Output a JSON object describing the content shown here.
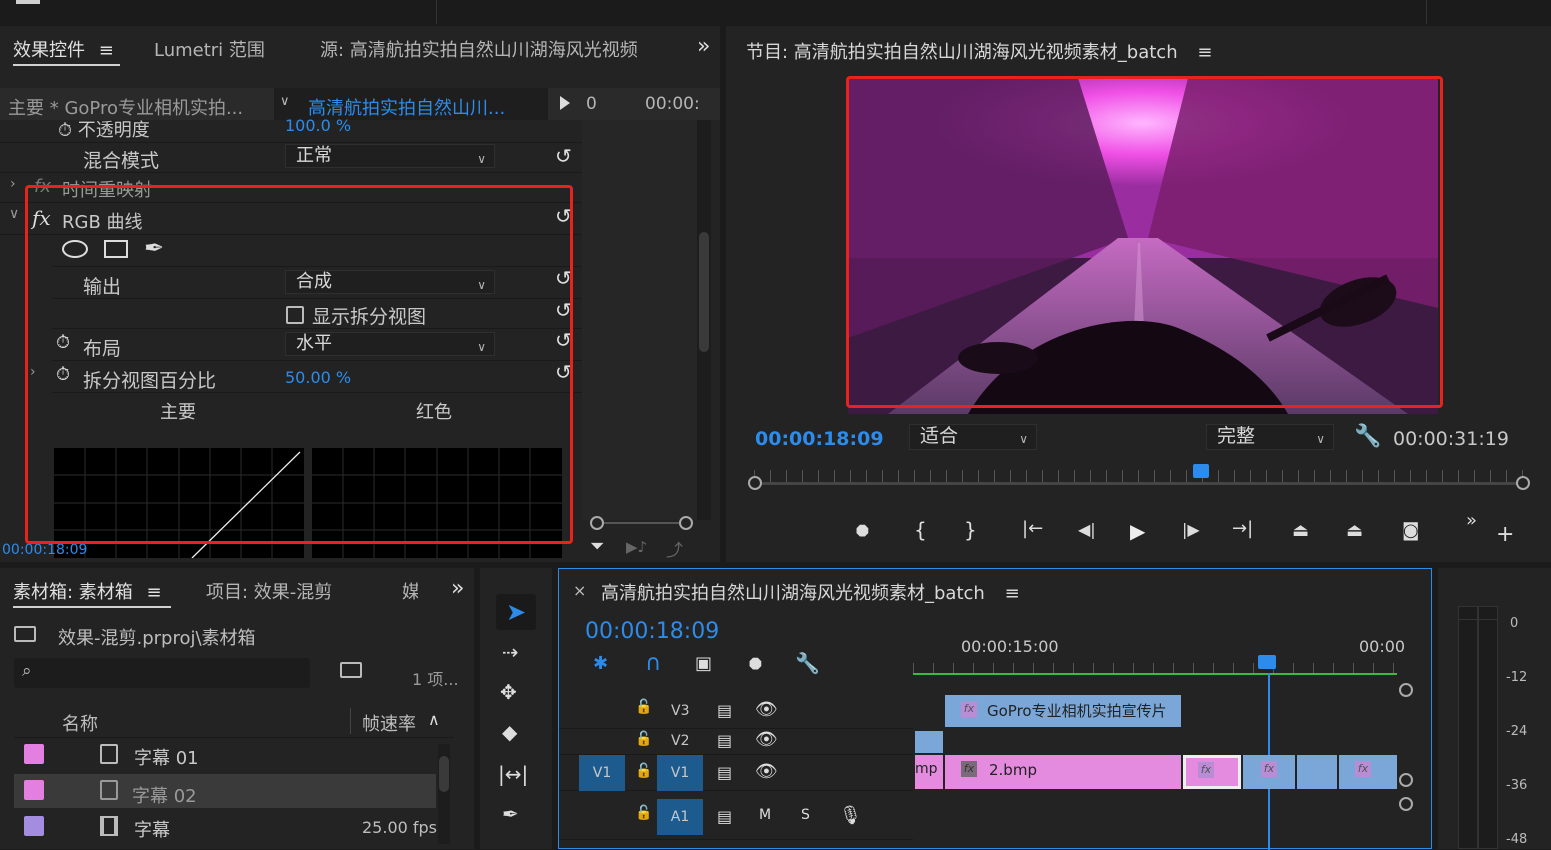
{
  "effect_controls": {
    "tabs": [
      "效果控件",
      "Lumetri 范围",
      "源: 高清航拍实拍自然山川湖海风光视频"
    ],
    "overflow": "»",
    "master_clip": "主要 * GoPro专业相机实拍...",
    "sequence_clip": "高清航拍实拍自然山川...",
    "ruler_times": [
      "0",
      "00:00:"
    ],
    "rows": {
      "opacity_label": "不透明度",
      "opacity_value": "100.0",
      "opacity_unit": "%",
      "blend_label": "混合模式",
      "blend_value": "正常",
      "timeremap_label": "时间重映射",
      "rgb_label": "RGB 曲线",
      "output_label": "输出",
      "output_value": "合成",
      "split_label": "显示拆分视图",
      "layout_label": "布局",
      "layout_value": "水平",
      "split_pct_label": "拆分视图百分比",
      "split_pct_value": "50.00",
      "split_pct_unit": "%",
      "curve_main": "主要",
      "curve_red": "红色"
    },
    "timecode": "00:00:18:09"
  },
  "program_monitor": {
    "title": "节目: 高清航拍实拍自然山川湖海风光视频素材_batch",
    "current_time": "00:00:18:09",
    "fit": "适合",
    "quality": "完整",
    "duration": "00:00:31:19",
    "playhead_fraction": 0.58
  },
  "bin_panel": {
    "tabs": [
      "素材箱: 素材箱",
      "项目: 效果-混剪",
      "媒"
    ],
    "overflow": "»",
    "path": "效果-混剪.prproj\\素材箱",
    "search_placeholder": "",
    "item_count": "1 项...",
    "columns": [
      "名称",
      "帧速率"
    ],
    "items": [
      {
        "name": "字幕 01",
        "fps": "",
        "color": "#e37fe0"
      },
      {
        "name": "字幕 02",
        "fps": "",
        "color": "#e37fe0"
      },
      {
        "name": "字幕",
        "fps": "25.00 fps",
        "color": "#a48de0"
      }
    ]
  },
  "timeline": {
    "title": "高清航拍实拍自然山川湖海风光视频素材_batch",
    "timecode": "00:00:18:09",
    "ruler": [
      "00:00:15:00",
      "00:00"
    ],
    "tracks": [
      "V3",
      "V2",
      "V1",
      "A1"
    ],
    "source_patch": "V1",
    "audio_m": "M",
    "audio_s": "S",
    "clips": {
      "v3": "GoPro专业相机实拍宣传片",
      "v1_left": "mp",
      "v1_main": "2.bmp",
      "fx": "fx"
    }
  },
  "audio_meter": {
    "labels": [
      "0",
      "-12",
      "-24",
      "-36",
      "-48"
    ]
  },
  "colors": {
    "accent_blue": "#2d8ceb",
    "highlight_red": "#e8231c",
    "clip_pink": "#e48be0",
    "clip_blue": "#7aa7d8"
  }
}
